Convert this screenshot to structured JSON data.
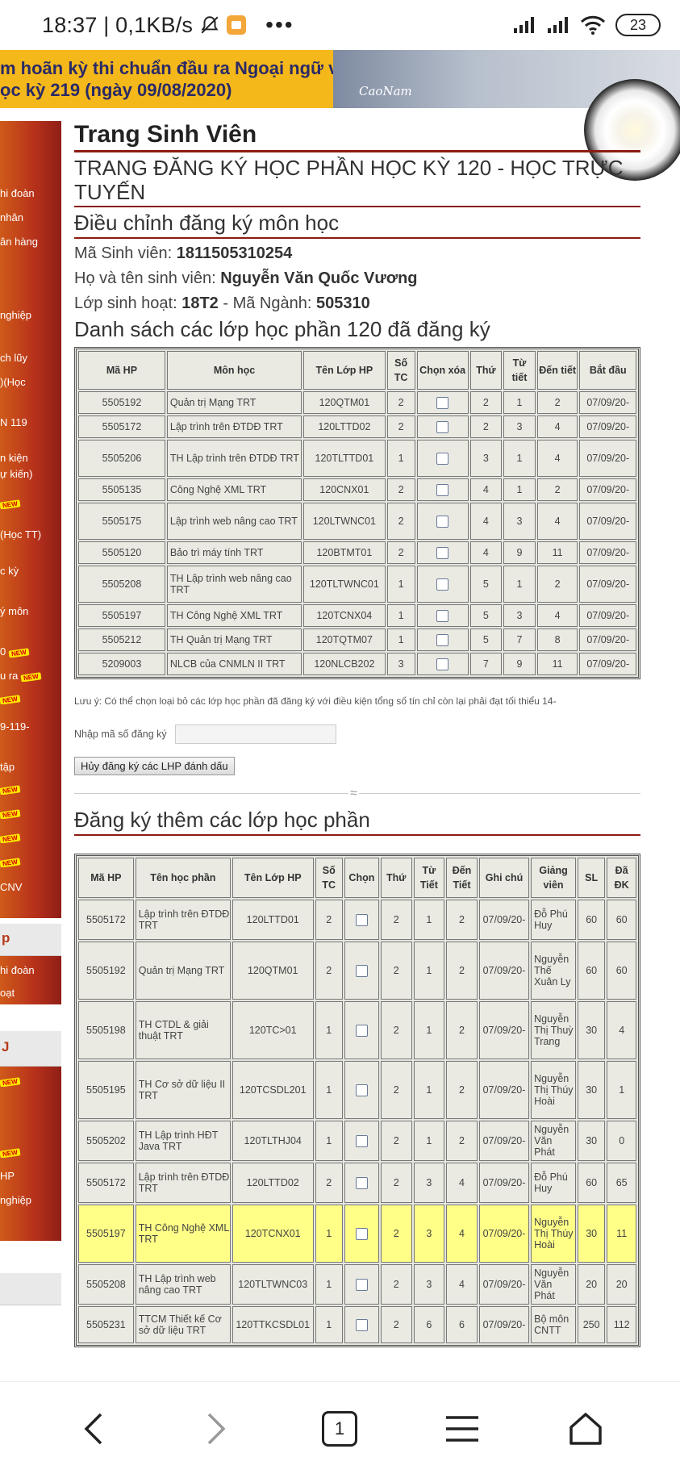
{
  "status_bar": {
    "time": "18:37 | 0,1KB/s",
    "dots": "•••",
    "battery": "23"
  },
  "banner": {
    "line1": "m hoãn kỳ thi chuẩn đầu ra Ngoại ngữ và",
    "line2": "ọc kỳ 219 (ngày 09/08/2020)",
    "signature": "CaoNam"
  },
  "sidebar": {
    "items": [
      "hi đoàn",
      "nhân",
      "ân hàng",
      "nghiệp",
      "ch lũy",
      ")(Học",
      "N 119",
      "n kiện",
      "ự kiến)",
      "(Học TT)",
      "c kỳ",
      "ý môn",
      "0",
      "u ra",
      "9-119-",
      "tập",
      "CNV",
      "hi đoàn",
      "oạt",
      "HP",
      "nghiệp"
    ],
    "heads": [
      "p",
      "J"
    ],
    "badge": "NEW"
  },
  "page": {
    "title": "Trang Sinh Viên",
    "subtitle": "TRANG ĐĂNG KÝ HỌC PHẦN HỌC KỲ 120 - HỌC TRỰC TUYẾN",
    "section": "Điều chỉnh đăng ký môn học",
    "student_id_label": "Mã Sinh viên: ",
    "student_id": "1811505310254",
    "name_label": "Họ và tên sinh viên: ",
    "name": "Nguyễn Văn Quốc Vương",
    "class_label": "Lớp sinh hoạt: ",
    "class": "18T2",
    "major_label": " - Mã Ngành: ",
    "major": "505310",
    "registered_title": "Danh sách các lớp học phần 120 đã đăng ký"
  },
  "registered": {
    "headers": [
      "Mã HP",
      "Môn học",
      "Tên Lớp HP",
      "Số TC",
      "Chọn xóa",
      "Thứ",
      "Từ tiết",
      "Đến tiết",
      "Bắt đầu"
    ],
    "rows": [
      [
        "5505192",
        "Quản trị Mạng TRT",
        "120QTM01",
        "2",
        "",
        "2",
        "1",
        "2",
        "07/09/20-"
      ],
      [
        "5505172",
        "Lập trình trên ĐTDĐ TRT",
        "120LTTD02",
        "2",
        "",
        "2",
        "3",
        "4",
        "07/09/20-"
      ],
      [
        "5505206",
        "TH Lập trình trên ĐTDĐ TRT",
        "120TLTTD01",
        "1",
        "",
        "3",
        "1",
        "4",
        "07/09/20-"
      ],
      [
        "5505135",
        "Công Nghệ XML TRT",
        "120CNX01",
        "2",
        "",
        "4",
        "1",
        "2",
        "07/09/20-"
      ],
      [
        "5505175",
        "Lập trình web nâng cao TRT",
        "120LTWNC01",
        "2",
        "",
        "4",
        "3",
        "4",
        "07/09/20-"
      ],
      [
        "5505120",
        "Bảo trì máy tính TRT",
        "120BTMT01",
        "2",
        "",
        "4",
        "9",
        "11",
        "07/09/20-"
      ],
      [
        "5505208",
        "TH Lập trình web nâng cao TRT",
        "120TLTWNC01",
        "1",
        "",
        "5",
        "1",
        "2",
        "07/09/20-"
      ],
      [
        "5505197",
        "TH Công Nghệ XML TRT",
        "120TCNX04",
        "1",
        "",
        "5",
        "3",
        "4",
        "07/09/20-"
      ],
      [
        "5505212",
        "TH Quản trị Mạng TRT",
        "120TQTM07",
        "1",
        "",
        "5",
        "7",
        "8",
        "07/09/20-"
      ],
      [
        "5209003",
        "NLCB của CNMLN II TRT",
        "120NLCB202",
        "3",
        "",
        "7",
        "9",
        "11",
        "07/09/20-"
      ]
    ]
  },
  "note": "Lưu ý: Có thể chọn loại bỏ các lớp học phần đã đăng ký với điều kiện tổng số tín chỉ còn lại phải đạt tối thiểu 14-",
  "register_code": {
    "label": "Nhập mã số đăng ký",
    "value": ""
  },
  "cancel_button": "Hủy đăng ký các LHP đánh dấu",
  "separator": "≈",
  "add_title": "Đăng ký thêm các lớp học phần",
  "available": {
    "headers": [
      "Mã HP",
      "Tên học phần",
      "Tên Lớp HP",
      "Số TC",
      "Chọn",
      "Thứ",
      "Từ Tiết",
      "Đến Tiết",
      "Ghi chú",
      "Giảng viên",
      "SL",
      "Đã ĐK"
    ],
    "rows": [
      [
        "5505172",
        "Lập trình trên ĐTDĐ TRT",
        "120LTTD01",
        "2",
        "",
        "2",
        "1",
        "2",
        "07/09/20-",
        "Đỗ Phú Huy",
        "60",
        "60"
      ],
      [
        "5505192",
        "Quản trị Mạng TRT",
        "120QTM01",
        "2",
        "",
        "2",
        "1",
        "2",
        "07/09/20-",
        "Nguyễn Thế Xuân Ly",
        "60",
        "60"
      ],
      [
        "5505198",
        "TH CTDL & giải thuật TRT",
        "120TC>01",
        "1",
        "",
        "2",
        "1",
        "2",
        "07/09/20-",
        "Nguyễn Thị Thuỳ Trang",
        "30",
        "4"
      ],
      [
        "5505195",
        "TH Cơ sở dữ liệu II TRT",
        "120TCSDL201",
        "1",
        "",
        "2",
        "1",
        "2",
        "07/09/20-",
        "Nguyễn Thị Thúy Hoài",
        "30",
        "1"
      ],
      [
        "5505202",
        "TH Lập trình HĐT Java TRT",
        "120TLTHJ04",
        "1",
        "",
        "2",
        "1",
        "2",
        "07/09/20-",
        "Nguyễn Văn Phát",
        "30",
        "0"
      ],
      [
        "5505172",
        "Lập trình trên ĐTDĐ TRT",
        "120LTTD02",
        "2",
        "",
        "2",
        "3",
        "4",
        "07/09/20-",
        "Đỗ Phú Huy",
        "60",
        "65"
      ],
      [
        "5505197",
        "TH Công Nghệ XML TRT",
        "120TCNX01",
        "1",
        "",
        "2",
        "3",
        "4",
        "07/09/20-",
        "Nguyễn Thị Thúy Hoài",
        "30",
        "11"
      ],
      [
        "5505208",
        "TH Lập trình web nâng cao TRT",
        "120TLTWNC03",
        "1",
        "",
        "2",
        "3",
        "4",
        "07/09/20-",
        "Nguyễn Văn Phát",
        "20",
        "20"
      ],
      [
        "5505231",
        "TTCM Thiết kế Cơ sở dữ liệu TRT",
        "120TTKCSDL01",
        "1",
        "",
        "2",
        "6",
        "6",
        "07/09/20-",
        "Bộ môn CNTT",
        "250",
        "112"
      ]
    ],
    "highlight_row": "5505197"
  },
  "nav": {
    "tab_count": "1"
  }
}
